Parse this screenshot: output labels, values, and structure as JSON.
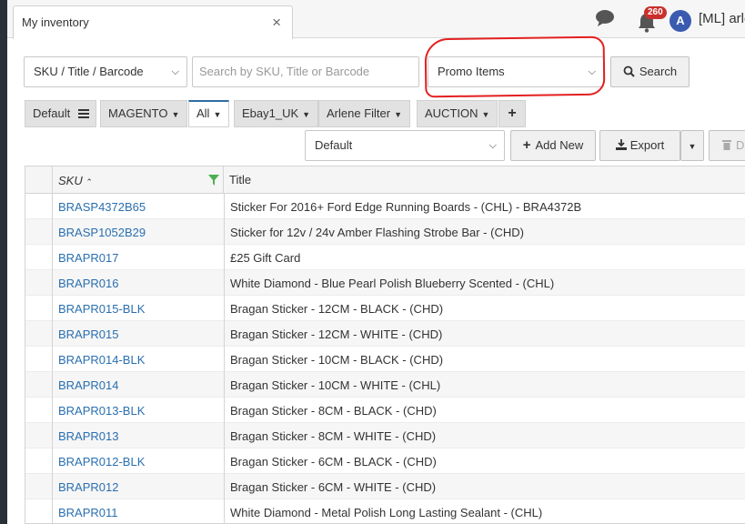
{
  "header": {
    "tab_label": "My inventory",
    "tab_close": "×",
    "notifications_count": "260",
    "avatar_letter": "A",
    "user_name": "[ML] arle"
  },
  "search": {
    "field_select": "SKU / Title / Barcode",
    "placeholder": "Search by SKU, Title or Barcode",
    "promo_select": "Promo Items",
    "search_button": "Search"
  },
  "filters": {
    "default_label": "Default",
    "tabs": [
      "MAGENTO",
      "All",
      "Ebay1_UK",
      "Arlene Filter",
      "AUCTION"
    ],
    "add": "+"
  },
  "toolbar": {
    "view_select": "Default",
    "add_new": "Add New",
    "export": "Export",
    "delete_partial": "D"
  },
  "table": {
    "columns": [
      "SKU",
      "Title"
    ],
    "rows": [
      {
        "sku": "BRASP4372B65",
        "title": "Sticker For 2016+ Ford Edge Running Boards - (CHL) - BRA4372B"
      },
      {
        "sku": "BRASP1052B29",
        "title": "Sticker for 12v / 24v Amber Flashing Strobe Bar - (CHD)"
      },
      {
        "sku": "BRAPR017",
        "title": "£25 Gift Card"
      },
      {
        "sku": "BRAPR016",
        "title": "White Diamond - Blue Pearl Polish Blueberry Scented - (CHL)"
      },
      {
        "sku": "BRAPR015-BLK",
        "title": "Bragan Sticker - 12CM - BLACK - (CHD)"
      },
      {
        "sku": "BRAPR015",
        "title": "Bragan Sticker - 12CM - WHITE - (CHD)"
      },
      {
        "sku": "BRAPR014-BLK",
        "title": "Bragan Sticker - 10CM - BLACK - (CHD)"
      },
      {
        "sku": "BRAPR014",
        "title": "Bragan Sticker - 10CM - WHITE - (CHL)"
      },
      {
        "sku": "BRAPR013-BLK",
        "title": "Bragan Sticker - 8CM - BLACK - (CHD)"
      },
      {
        "sku": "BRAPR013",
        "title": "Bragan Sticker - 8CM - WHITE - (CHD)"
      },
      {
        "sku": "BRAPR012-BLK",
        "title": "Bragan Sticker - 6CM - BLACK - (CHD)"
      },
      {
        "sku": "BRAPR012",
        "title": "Bragan Sticker - 6CM - WHITE - (CHD)"
      },
      {
        "sku": "BRAPR011",
        "title": "White Diamond - Metal Polish Long Lasting Sealant - (CHL)"
      }
    ]
  },
  "colors": {
    "link": "#2a6fb0",
    "annotation": "#e32020",
    "badge": "#c9302c",
    "avatar": "#3b5bb0",
    "filter_icon": "#4caf50"
  },
  "icons": [
    "chat-icon",
    "bell-icon",
    "search-icon",
    "hamburger-icon",
    "plus-icon",
    "download-icon",
    "trash-icon",
    "filter-icon",
    "sort-up-icon",
    "chevron-down-icon"
  ]
}
